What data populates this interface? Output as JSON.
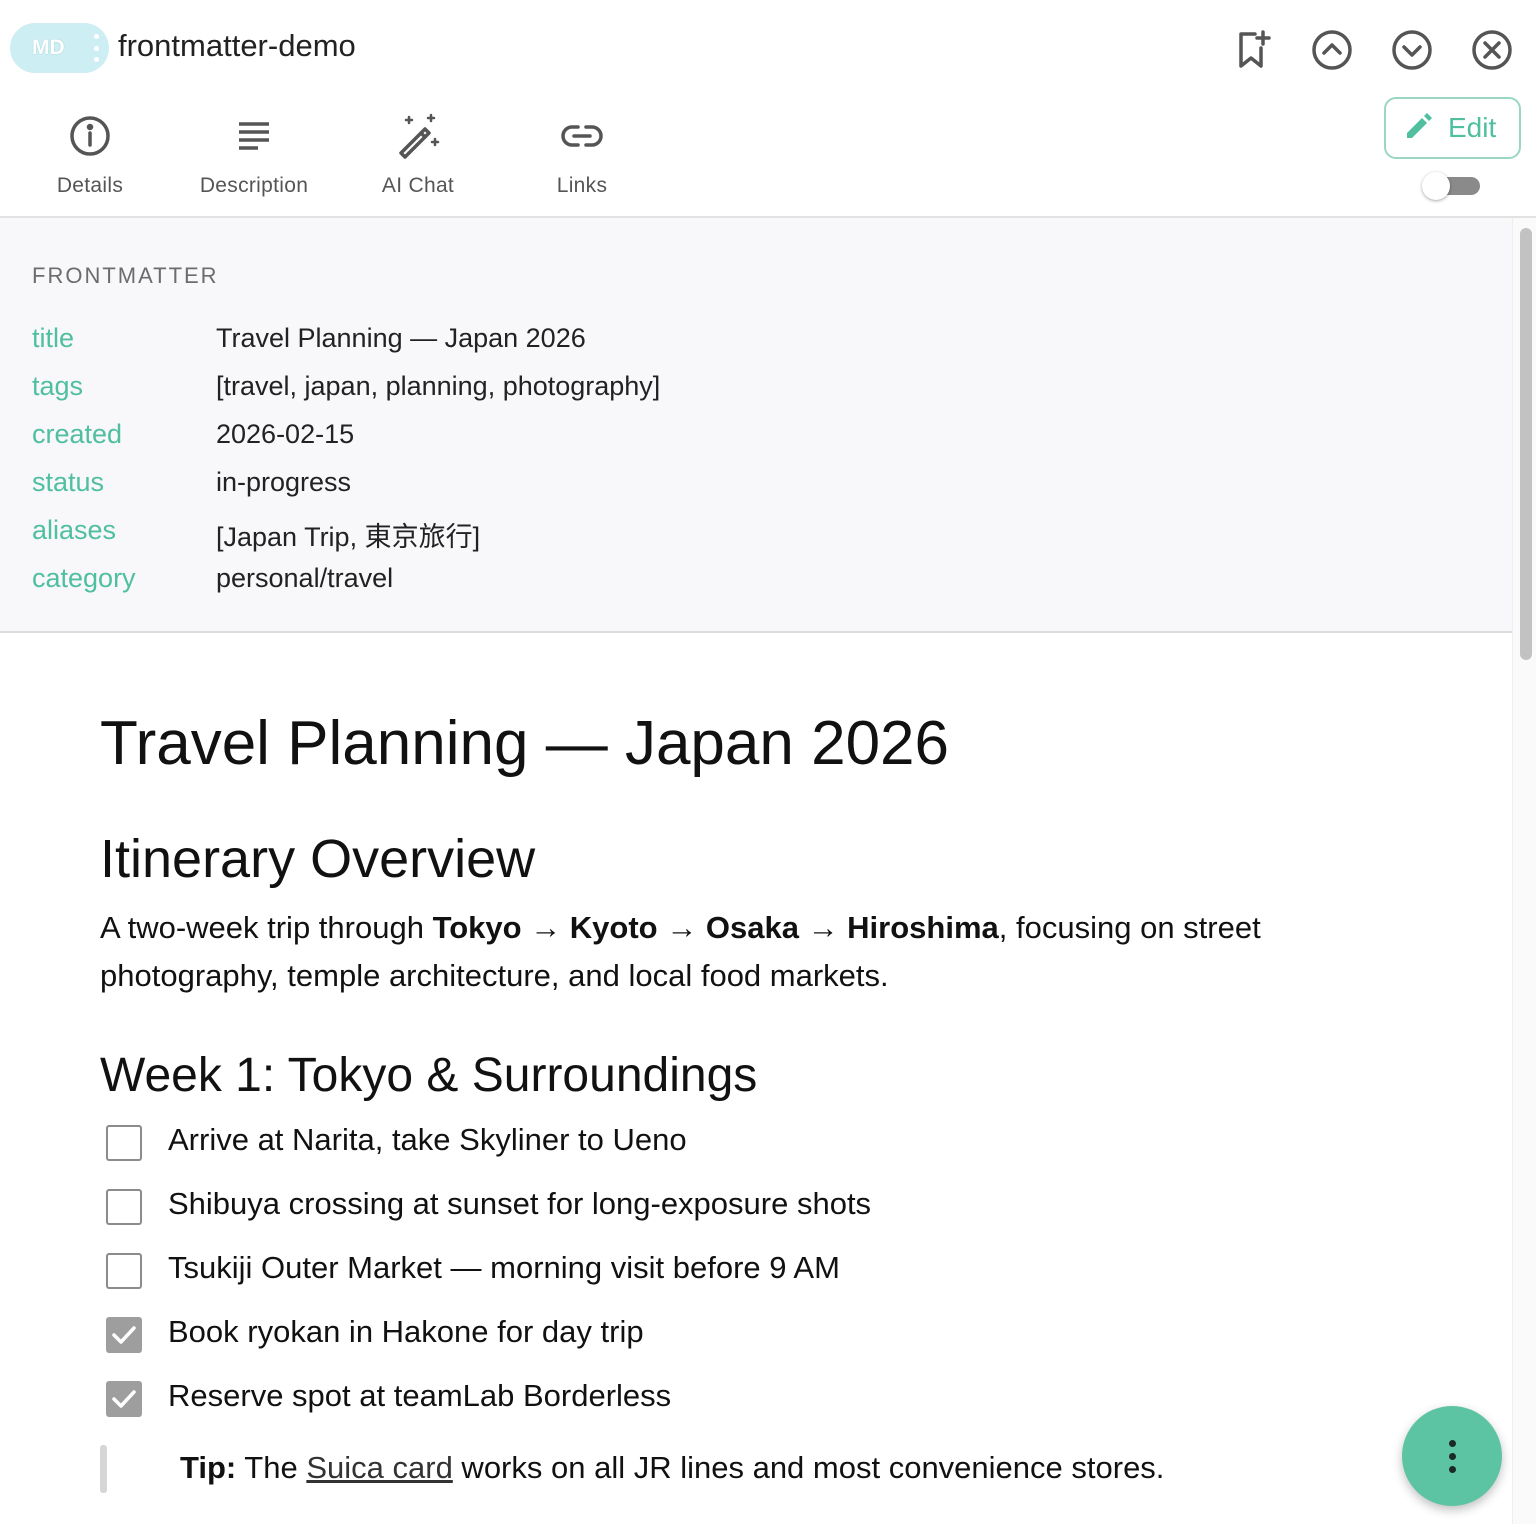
{
  "header": {
    "badge_label": "MD",
    "document_name": "frontmatter-demo",
    "icons": [
      "bookmark-add-icon",
      "chevron-up-circle-icon",
      "chevron-down-circle-icon",
      "close-circle-icon"
    ]
  },
  "tabs": [
    {
      "label": "Details",
      "icon": "info-icon"
    },
    {
      "label": "Description",
      "icon": "text-lines-icon"
    },
    {
      "label": "AI Chat",
      "icon": "magic-wand-icon"
    },
    {
      "label": "Links",
      "icon": "link-icon"
    }
  ],
  "edit_button": {
    "label": "Edit",
    "icon": "pencil-icon"
  },
  "toggle": {
    "on": false
  },
  "frontmatter": {
    "heading": "FRONTMATTER",
    "rows": [
      {
        "key": "title",
        "value": "Travel Planning — Japan 2026"
      },
      {
        "key": "tags",
        "value": "[travel, japan, planning, photography]"
      },
      {
        "key": "created",
        "value": "2026-02-15"
      },
      {
        "key": "status",
        "value": "in-progress"
      },
      {
        "key": "aliases",
        "value": "[Japan Trip, 東京旅行]"
      },
      {
        "key": "category",
        "value": "personal/travel"
      }
    ]
  },
  "document": {
    "h1": "Travel Planning — Japan 2026",
    "h2": "Itinerary Overview",
    "paragraph": {
      "intro": "A two-week trip through ",
      "city1": "Tokyo",
      "arrow": " → ",
      "city2": "Kyoto",
      "city3": "Osaka",
      "city4": "Hiroshima",
      "rest": ", focusing on street photography, temple architecture, and local food markets."
    },
    "h3": "Week 1: Tokyo & Surroundings",
    "tasks": [
      {
        "text": "Arrive at Narita, take Skyliner to Ueno",
        "checked": false
      },
      {
        "text": "Shibuya crossing at sunset for long-exposure shots",
        "checked": false
      },
      {
        "text": "Tsukiji Outer Market — morning visit before 9 AM",
        "checked": false
      },
      {
        "text": "Book ryokan in Hakone for day trip",
        "checked": true
      },
      {
        "text": "Reserve spot at teamLab Borderless",
        "checked": true
      }
    ],
    "tip": {
      "label": "Tip:",
      "before_link": " The ",
      "link": "Suica card",
      "after_link": " works on all JR lines and most convenience stores."
    }
  },
  "colors": {
    "accent": "#4fbf9f",
    "fab": "#5cc3a3",
    "badge": "#cdeef2",
    "frontmatter_bg": "#f8f7fa"
  },
  "fab": {
    "icon": "more-vertical-icon"
  }
}
